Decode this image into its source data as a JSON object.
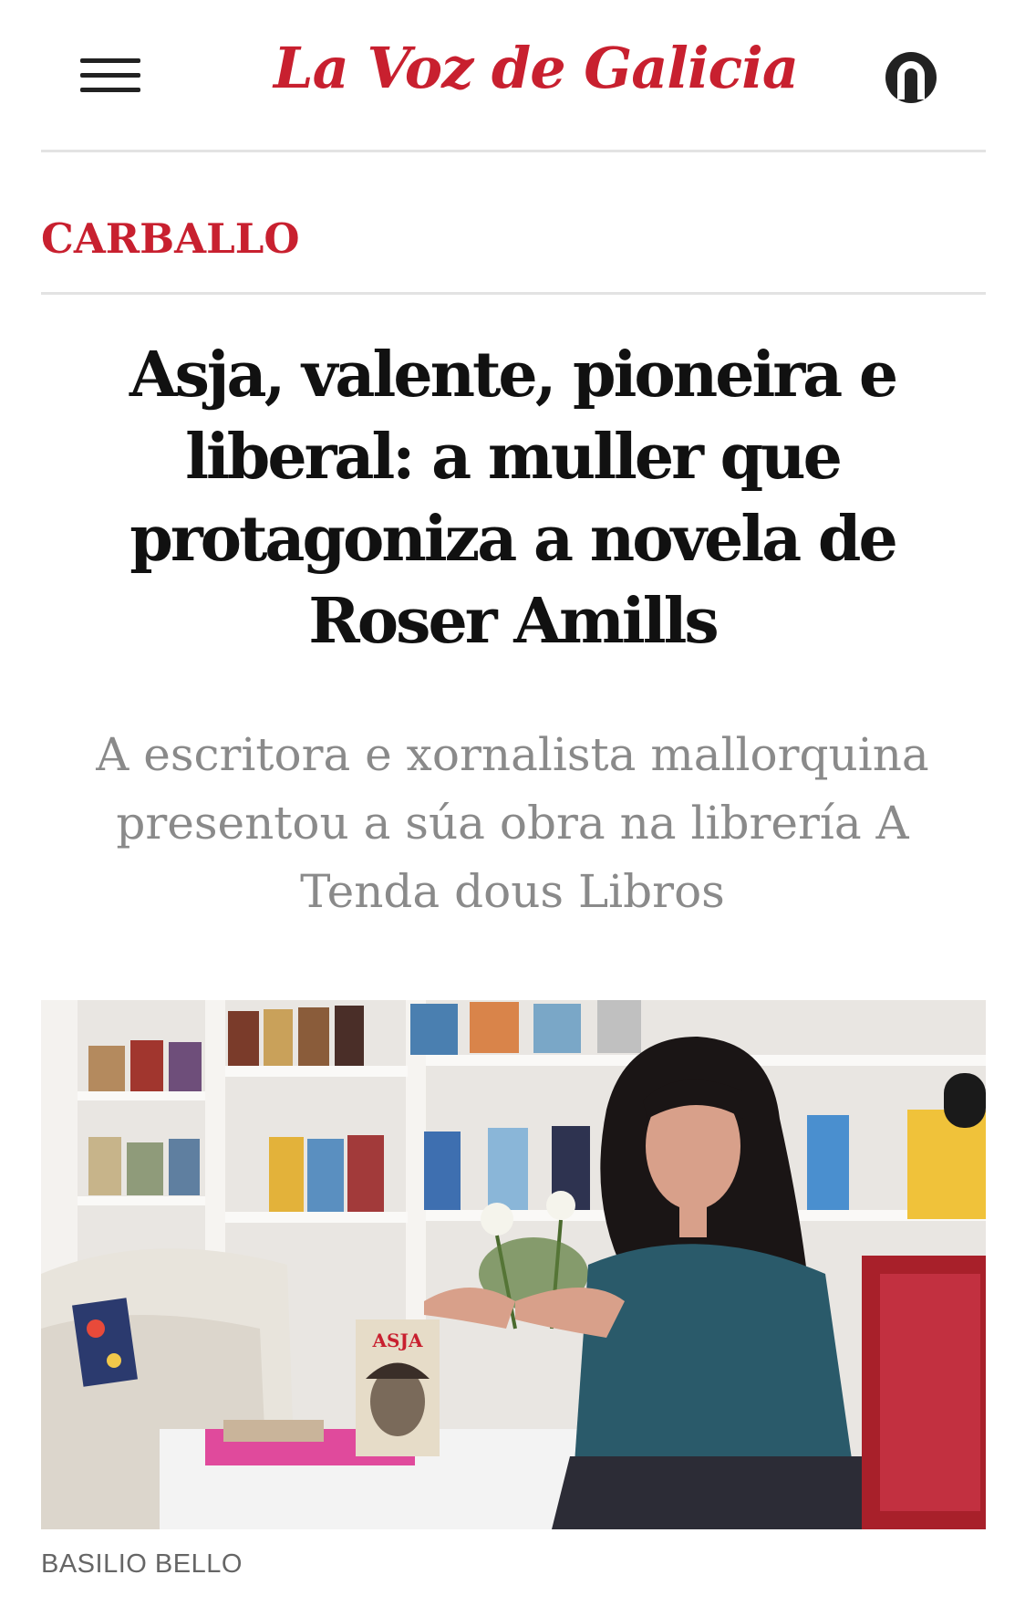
{
  "header": {
    "menu_icon": "hamburger-menu-icon",
    "logo_text": "La Voz de Galicia",
    "user_icon": "user-account-icon",
    "brand_color": "#c8202f"
  },
  "article": {
    "section": "CARBALLO",
    "headline": "Asja, valente, pioneira e liberal: a muller que protagoniza a novela de Roser Amills",
    "subtitle": "A escritora e xornalista mallorquina presentou a súa obra na librería A Tenda dous Libros",
    "photo": {
      "book_cover_title": "ASJA",
      "credit": "BASILIO BELLO"
    }
  }
}
